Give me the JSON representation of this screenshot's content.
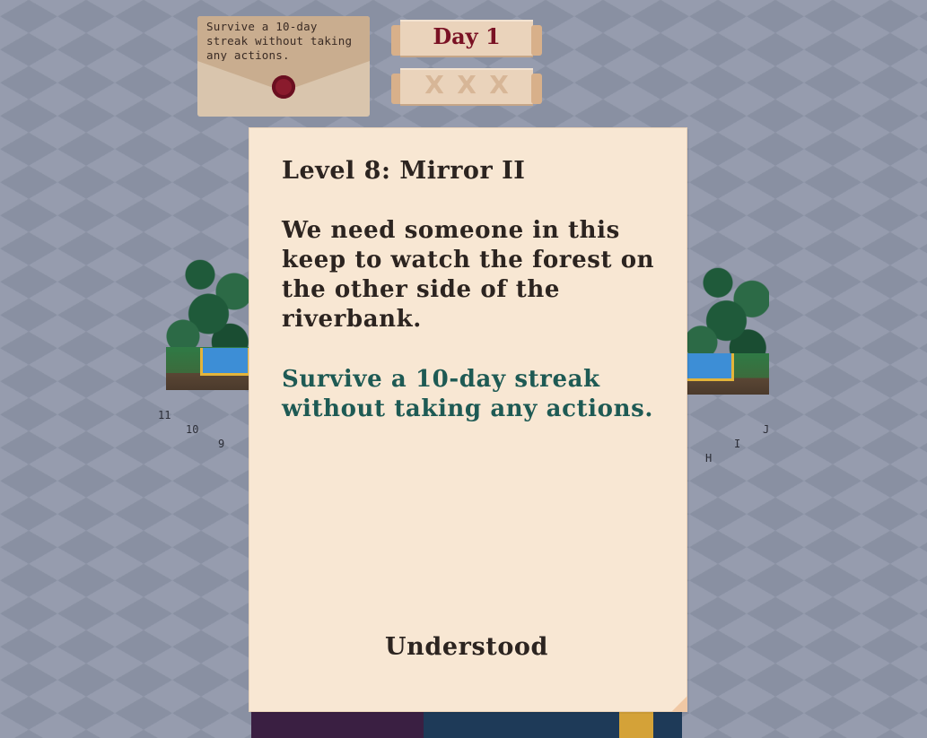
{
  "objective_card": {
    "text": "Survive a 10-day streak without taking any actions."
  },
  "day_scroll": {
    "label": "Day 1"
  },
  "strikes": {
    "marks": [
      "X",
      "X",
      "X"
    ]
  },
  "map_coords": {
    "left": [
      "11",
      "10",
      "9"
    ],
    "right": [
      "J",
      "I",
      "H"
    ]
  },
  "dialog": {
    "title": "Level 8: Mirror II",
    "description": "We need someone in this keep to watch the forest on the other side of the riverbank.",
    "goal": "Survive a 10-day streak without taking any actions.",
    "confirm_label": "Understood"
  },
  "colors": {
    "background": "#8f96a9",
    "dialog_paper": "#f8e7d3",
    "goal_text": "#1e5a54",
    "day_text": "#7a1224",
    "wax_seal": "#8a1b2d"
  },
  "icons": [
    "wax-seal-icon",
    "strike-x-icon"
  ]
}
